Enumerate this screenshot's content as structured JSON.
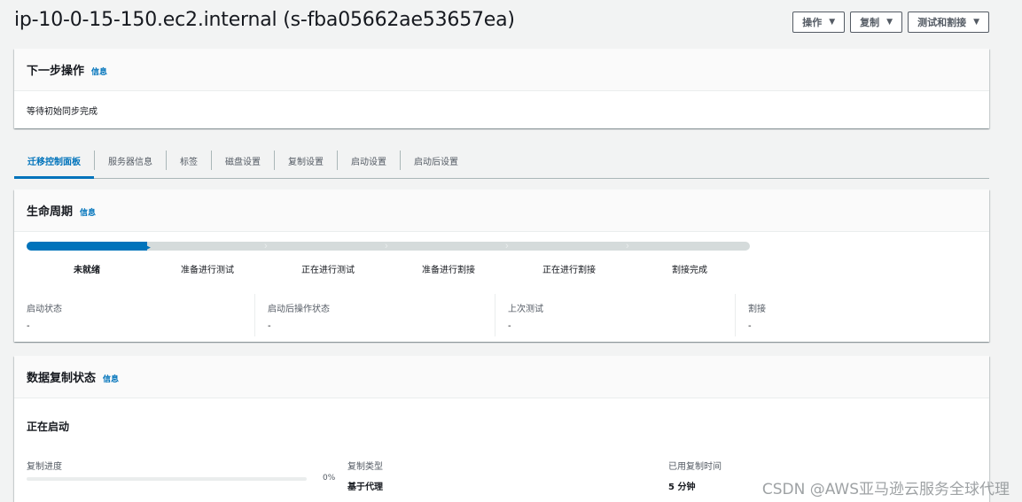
{
  "page": {
    "title": "ip-10-0-15-150.ec2.internal (s-fba05662ae53657ea)"
  },
  "actions": {
    "operate": "操作",
    "replicate": "复制",
    "test_cutover": "测试和割接"
  },
  "next_steps": {
    "title": "下一步操作",
    "info": "信息",
    "message": "等待初始同步完成"
  },
  "tabs": [
    {
      "label": "迁移控制面板",
      "active": true
    },
    {
      "label": "服务器信息",
      "active": false
    },
    {
      "label": "标签",
      "active": false
    },
    {
      "label": "磁盘设置",
      "active": false
    },
    {
      "label": "复制设置",
      "active": false
    },
    {
      "label": "启动设置",
      "active": false
    },
    {
      "label": "启动后设置",
      "active": false
    }
  ],
  "lifecycle": {
    "title": "生命周期",
    "info": "信息",
    "progress_steps_completed": 1,
    "progress_steps_total": 6,
    "steps": [
      "未就绪",
      "准备进行测试",
      "正在进行测试",
      "准备进行割接",
      "正在进行割接",
      "割接完成"
    ],
    "current_step": 0,
    "stats": [
      {
        "label": "启动状态",
        "value": "-"
      },
      {
        "label": "启动后操作状态",
        "value": "-"
      },
      {
        "label": "上次测试",
        "value": "-"
      },
      {
        "label": "割接",
        "value": "-"
      }
    ]
  },
  "replication": {
    "title": "数据复制状态",
    "info": "信息",
    "status": "正在启动",
    "progress_label": "复制进度",
    "progress_percent": "0%",
    "progress_value": 0,
    "type_label": "复制类型",
    "type_value": "基于代理",
    "elapsed_label": "已用复制时间",
    "elapsed_value": "5 分钟"
  },
  "watermark": "CSDN @AWS亚马逊云服务全球代理",
  "colors": {
    "accent": "#0073bb",
    "track": "#d5dbdb"
  }
}
